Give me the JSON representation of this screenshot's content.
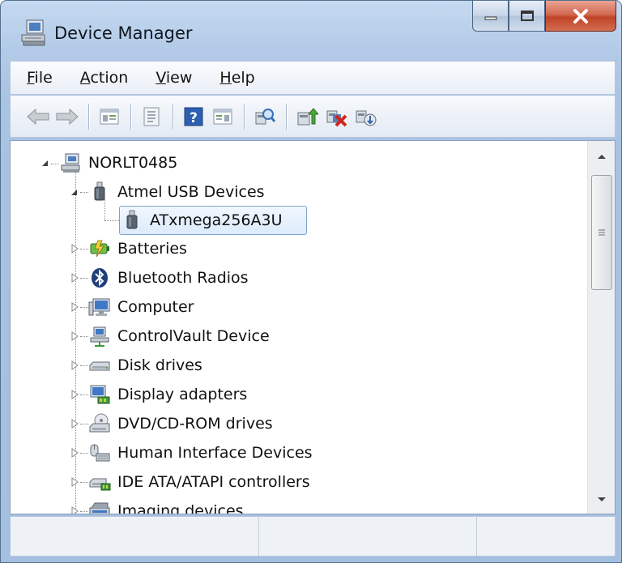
{
  "window": {
    "title": "Device Manager"
  },
  "menu": {
    "items": [
      {
        "label": "File",
        "accel": "F",
        "rest": "ile"
      },
      {
        "label": "Action",
        "accel": "A",
        "rest": "ction"
      },
      {
        "label": "View",
        "accel": "V",
        "rest": "iew"
      },
      {
        "label": "Help",
        "accel": "H",
        "rest": "elp"
      }
    ]
  },
  "toolbar": {
    "buttons": [
      "back-arrow-icon",
      "forward-arrow-icon",
      "show-hide-console-tree-icon",
      "properties-icon",
      "help-icon",
      "show-action-pane-icon",
      "scan-hardware-icon",
      "update-driver-icon",
      "disable-device-icon",
      "uninstall-device-icon"
    ]
  },
  "tree": {
    "root": {
      "label": "NORLT0485",
      "icon": "computer-network-icon",
      "expanded": true
    },
    "nodes": [
      {
        "label": "Atmel USB Devices",
        "icon": "usb-plug-icon",
        "expanded": true,
        "level": 1
      },
      {
        "label": "ATxmega256A3U",
        "icon": "usb-plug-icon",
        "level": 2,
        "selected": true
      },
      {
        "label": "Batteries",
        "icon": "battery-icon",
        "expanded": false,
        "level": 1
      },
      {
        "label": "Bluetooth Radios",
        "icon": "bluetooth-icon",
        "expanded": false,
        "level": 1
      },
      {
        "label": "Computer",
        "icon": "monitor-icon",
        "expanded": false,
        "level": 1
      },
      {
        "label": "ControlVault Device",
        "icon": "controlvault-icon",
        "expanded": false,
        "level": 1
      },
      {
        "label": "Disk drives",
        "icon": "disk-drive-icon",
        "expanded": false,
        "level": 1
      },
      {
        "label": "Display adapters",
        "icon": "display-adapter-icon",
        "expanded": false,
        "level": 1
      },
      {
        "label": "DVD/CD-ROM drives",
        "icon": "dvd-drive-icon",
        "expanded": false,
        "level": 1
      },
      {
        "label": "Human Interface Devices",
        "icon": "hid-icon",
        "expanded": false,
        "level": 1
      },
      {
        "label": "IDE ATA/ATAPI controllers",
        "icon": "ide-controller-icon",
        "expanded": false,
        "level": 1
      },
      {
        "label": "Imaging devices",
        "icon": "imaging-device-icon",
        "expanded": false,
        "level": 1
      }
    ]
  },
  "colors": {
    "selection_border": "#7da2ce",
    "selection_fill": "#dcebfc",
    "close_button": "#c04327"
  }
}
